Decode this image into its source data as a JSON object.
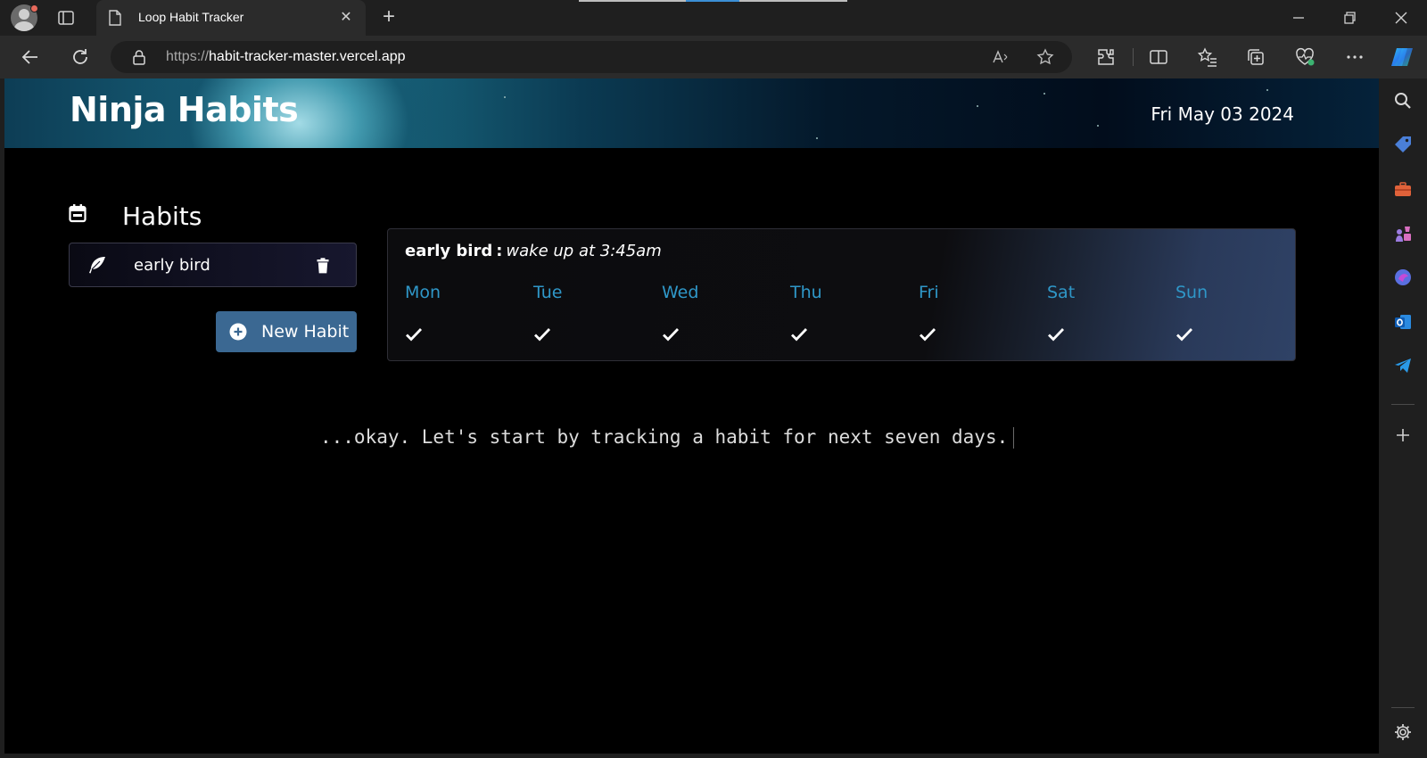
{
  "browser": {
    "tab_title": "Loop Habit Tracker",
    "url_scheme": "https://",
    "url_host": "habit-tracker-master.vercel.app"
  },
  "app": {
    "title": "Ninja Habits",
    "date": "Fri May 03 2024"
  },
  "sidebar": {
    "heading": "Habits",
    "habits": [
      {
        "name": "early bird"
      }
    ],
    "new_habit_label": "New Habit"
  },
  "week_card": {
    "habit_name": "early bird",
    "separator": ":",
    "goal": "wake up at 3:45am",
    "days": [
      {
        "label": "Mon",
        "checked": true
      },
      {
        "label": "Tue",
        "checked": true
      },
      {
        "label": "Wed",
        "checked": true
      },
      {
        "label": "Thu",
        "checked": true
      },
      {
        "label": "Fri",
        "checked": true
      },
      {
        "label": "Sat",
        "checked": true
      },
      {
        "label": "Sun",
        "checked": true
      }
    ]
  },
  "message": "...okay. Let's start by tracking a habit for next seven days.",
  "colors": {
    "day_label": "#2f97c8",
    "new_habit_button": "#3b6892",
    "page_background": "#000000"
  },
  "icons": {
    "habits_heading": "calendar-icon",
    "habit_item": "feather-icon",
    "habit_delete": "trash-icon",
    "new_habit": "plus-circle-icon",
    "day_status": "checkmark-icon"
  }
}
